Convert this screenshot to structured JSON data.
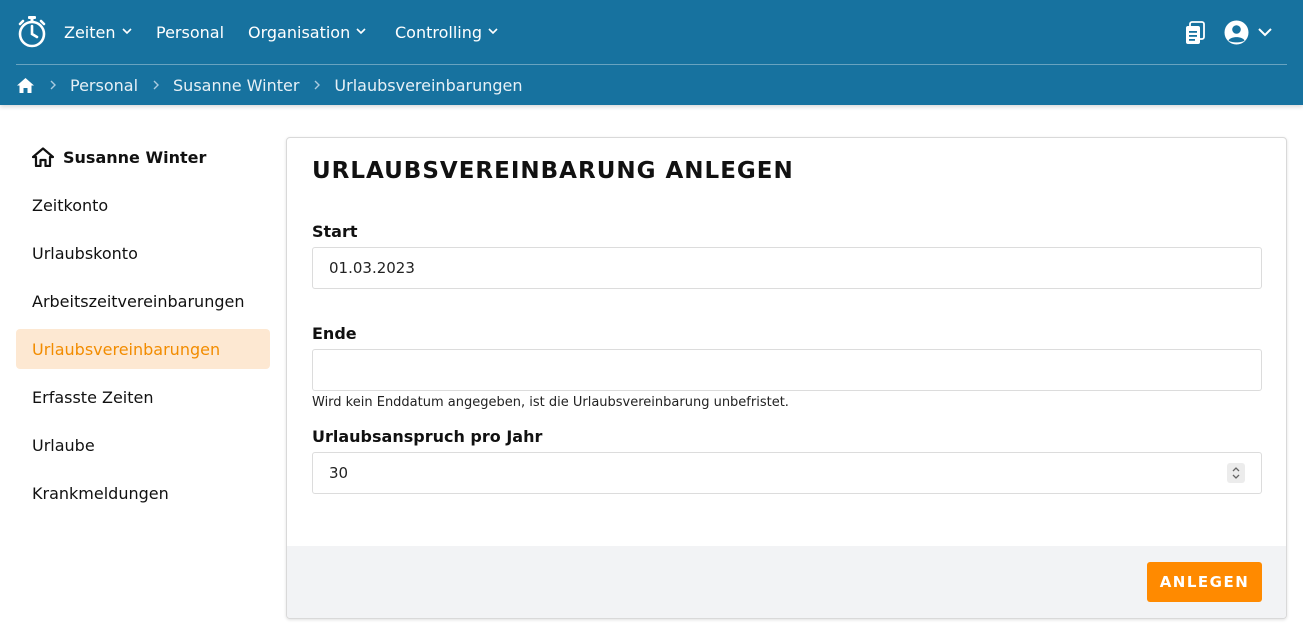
{
  "header": {
    "nav": [
      {
        "label": "Zeiten",
        "has_dropdown": true
      },
      {
        "label": "Personal",
        "has_dropdown": false
      },
      {
        "label": "Organisation",
        "has_dropdown": true
      },
      {
        "label": "Controlling",
        "has_dropdown": true
      }
    ],
    "icons": [
      "stopwatch-logo-icon",
      "clipboard-icon",
      "user-circle-icon",
      "chevron-down-icon"
    ],
    "bar_color": "#17729f"
  },
  "breadcrumb": {
    "items": [
      "Personal",
      "Susanne Winter",
      "Urlaubsvereinbarungen"
    ]
  },
  "sidebar": {
    "person": "Susanne Winter",
    "items": [
      {
        "label": "Zeitkonto",
        "active": false
      },
      {
        "label": "Urlaubskonto",
        "active": false
      },
      {
        "label": "Arbeitszeitvereinbarungen",
        "active": false
      },
      {
        "label": "Urlaubsvereinbarungen",
        "active": true
      },
      {
        "label": "Erfasste Zeiten",
        "active": false
      },
      {
        "label": "Urlaube",
        "active": false
      },
      {
        "label": "Krankmeldungen",
        "active": false
      }
    ],
    "active_color": "#f28c00"
  },
  "form": {
    "title": "URLAUBSVEREINBARUNG ANLEGEN",
    "start": {
      "label": "Start",
      "value": "01.03.2023"
    },
    "ende": {
      "label": "Ende",
      "value": "",
      "hint": "Wird kein Enddatum angegeben, ist die Urlaubsvereinbarung unbefristet."
    },
    "urlaubsanspruch": {
      "label": "Urlaubsanspruch pro Jahr",
      "value": "30"
    },
    "submit_label": "ANLEGEN",
    "accent_color": "#ff8a00"
  }
}
